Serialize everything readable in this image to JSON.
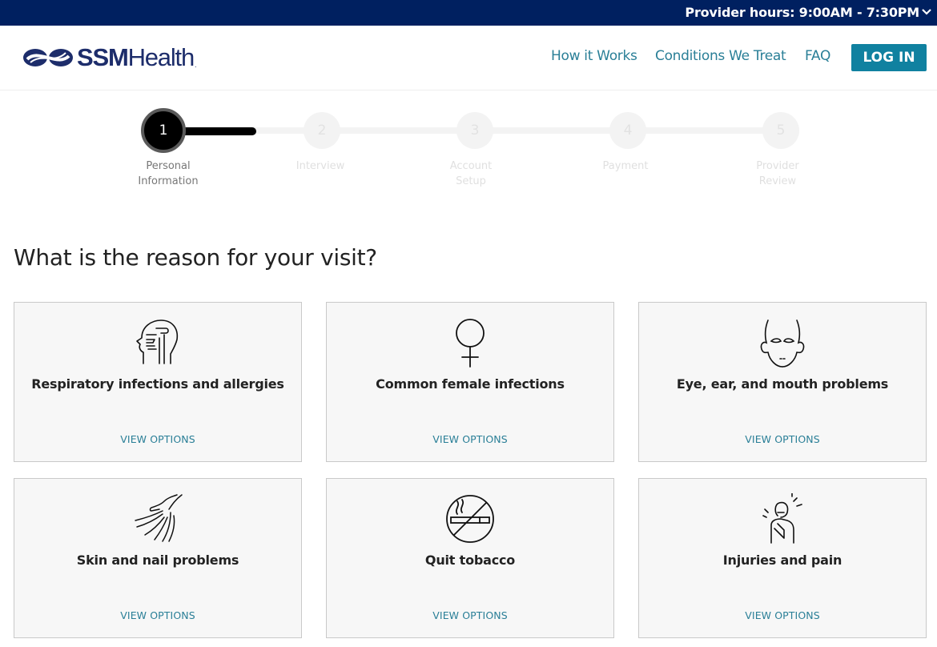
{
  "topbar": {
    "hours_label": "Provider hours: 9:00AM - 7:30PM",
    "background": "#002060"
  },
  "header": {
    "logo": {
      "brand_bold": "SSM",
      "brand_light": "Health",
      "trademark": "."
    },
    "nav": [
      "How it Works",
      "Conditions We Treat",
      "FAQ"
    ],
    "login_label": "LOG IN",
    "accent": "#1081a0",
    "link_color": "#2a7f97"
  },
  "stepper": {
    "current_step": 1,
    "progress_fraction": 0.15,
    "steps": [
      {
        "number": "1",
        "label": "Personal Information"
      },
      {
        "number": "2",
        "label": "Interview"
      },
      {
        "number": "3",
        "label": "Account Setup"
      },
      {
        "number": "4",
        "label": "Payment"
      },
      {
        "number": "5",
        "label": "Provider Review"
      }
    ]
  },
  "question": "What is the reason for your visit?",
  "cards": [
    {
      "title": "Respiratory infections and allergies",
      "link": "VIEW OPTIONS",
      "icon": "respiratory-icon"
    },
    {
      "title": "Common female infections",
      "link": "VIEW OPTIONS",
      "icon": "female-symbol-icon"
    },
    {
      "title": "Eye, ear, and mouth problems",
      "link": "VIEW OPTIONS",
      "icon": "face-icon"
    },
    {
      "title": "Skin and nail problems",
      "link": "VIEW OPTIONS",
      "icon": "hand-icon"
    },
    {
      "title": "Quit tobacco",
      "link": "VIEW OPTIONS",
      "icon": "no-smoking-icon"
    },
    {
      "title": "Injuries and pain",
      "link": "VIEW OPTIONS",
      "icon": "injury-icon"
    }
  ]
}
